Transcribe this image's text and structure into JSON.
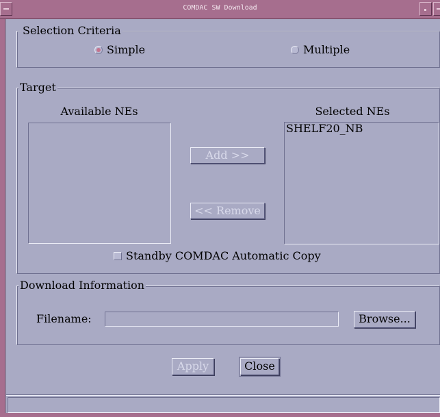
{
  "window": {
    "title": "COMDAC SW Download"
  },
  "selection_criteria": {
    "legend": "Selection Criteria",
    "options": [
      {
        "label": "Simple",
        "selected": true
      },
      {
        "label": "Multiple",
        "selected": false
      }
    ]
  },
  "target": {
    "legend": "Target",
    "available_label": "Available NEs",
    "selected_label": "Selected NEs",
    "available_items": [],
    "selected_items": [
      "SHELF20_NB"
    ],
    "add_label": "Add >>",
    "remove_label": "<< Remove",
    "standby_copy_label": "Standby COMDAC Automatic Copy",
    "standby_copy_checked": false
  },
  "download_info": {
    "legend": "Download Information",
    "filename_label": "Filename:",
    "filename_value": "",
    "browse_label": "Browse..."
  },
  "actions": {
    "apply_label": "Apply",
    "close_label": "Close"
  },
  "status": {
    "text": ""
  },
  "colors": {
    "background": "#a9aac4",
    "frame": "#a66e8e",
    "radio_selected": "#c4748e"
  }
}
